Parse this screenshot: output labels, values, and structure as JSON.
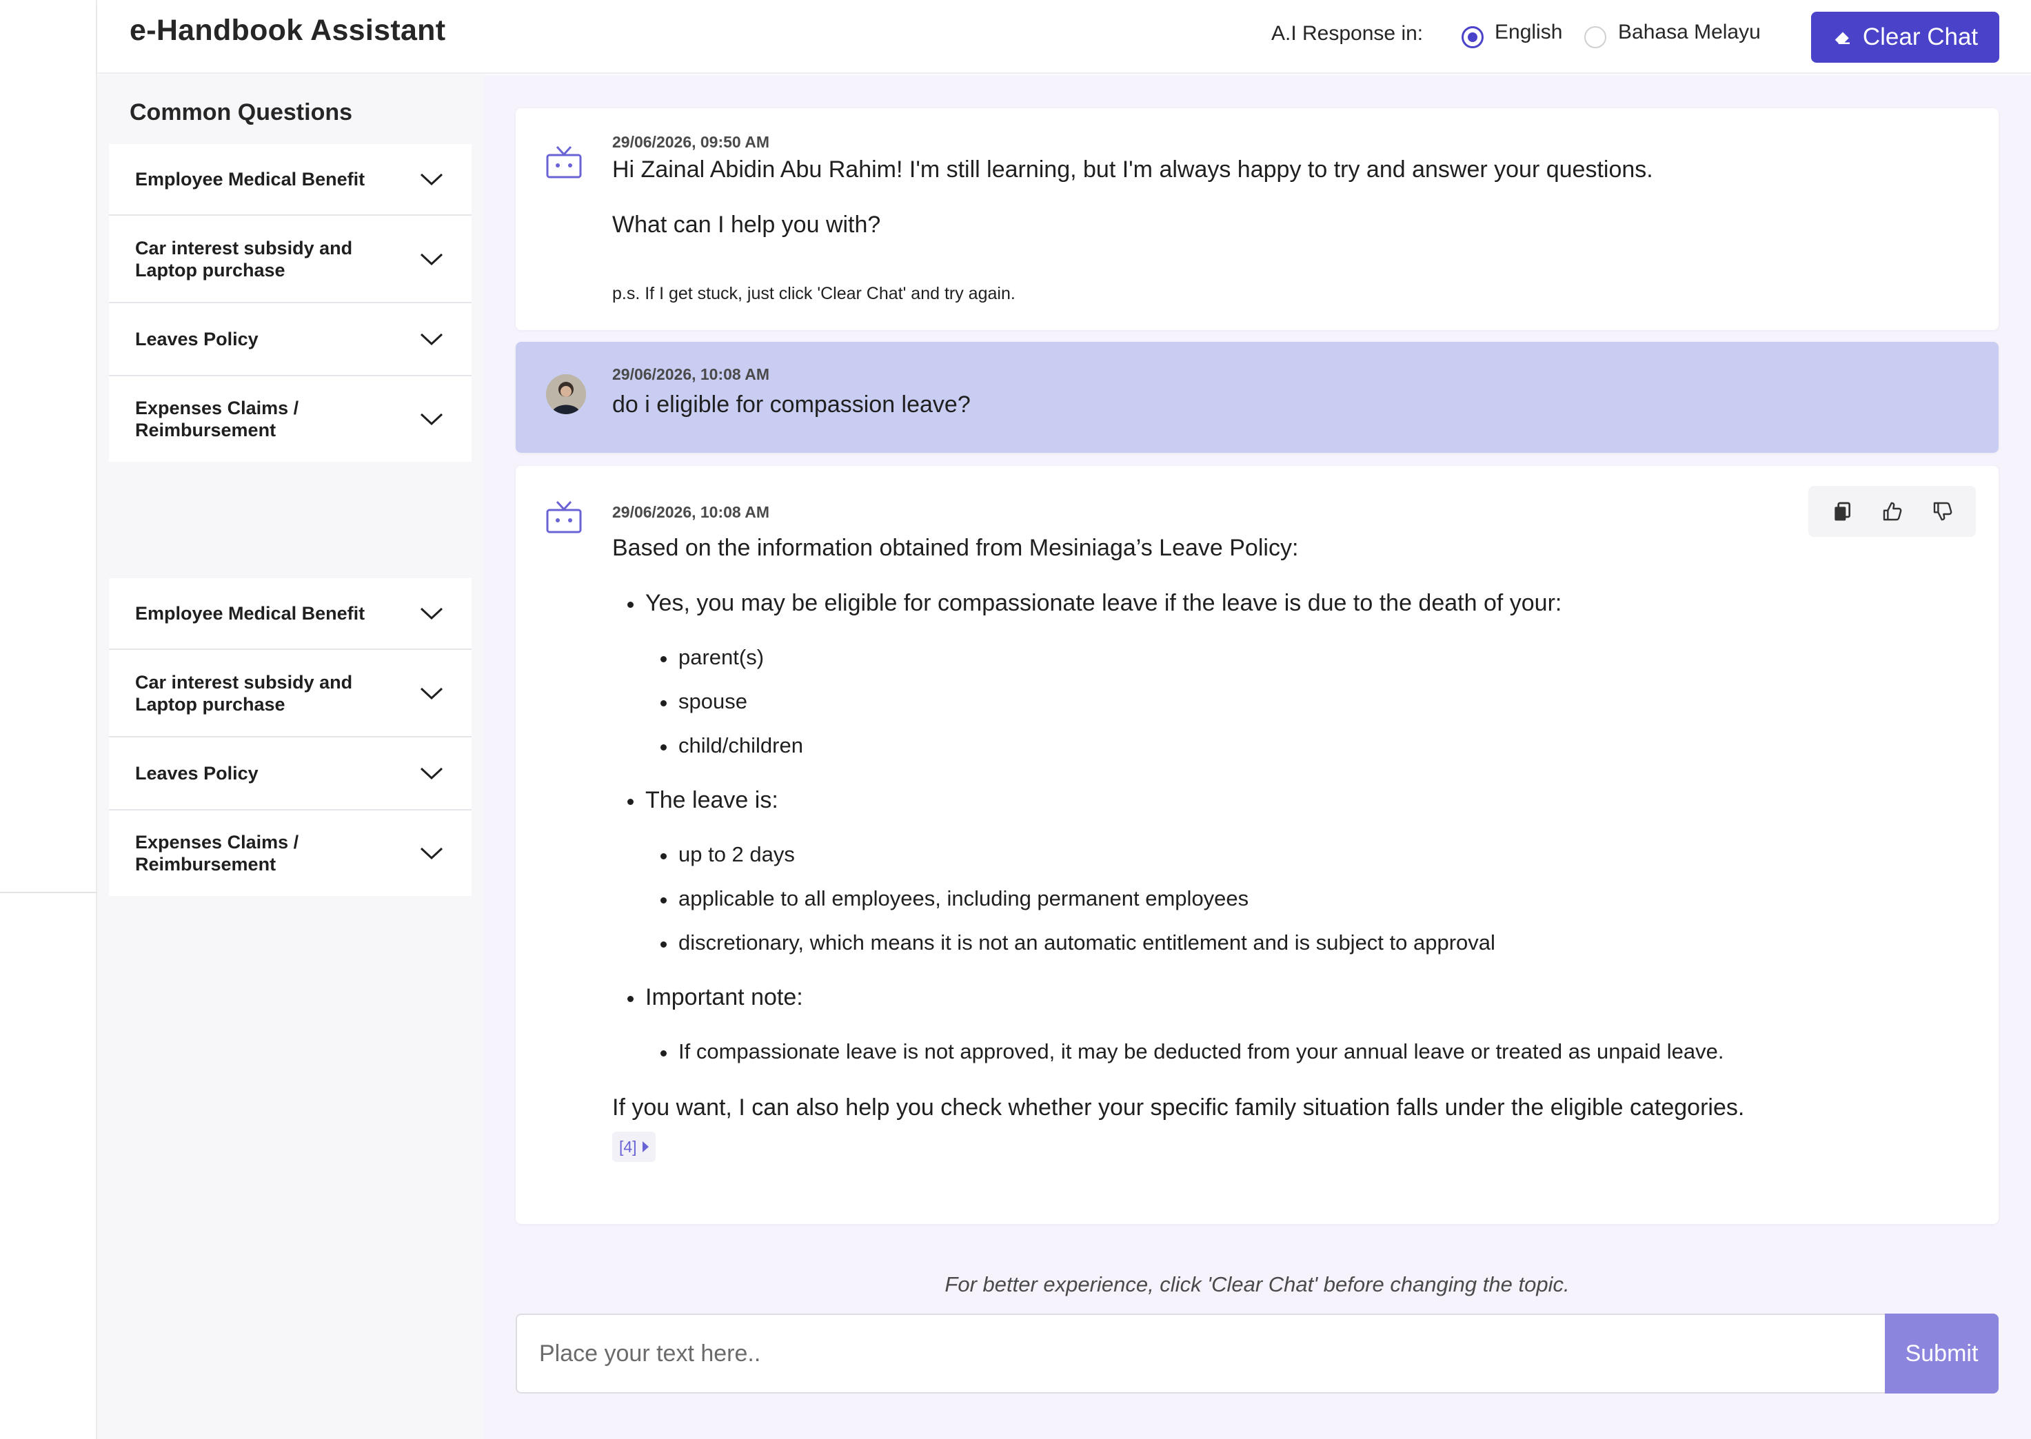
{
  "header": {
    "title": "e-Handbook Assistant",
    "language_label": "A.I Response in:",
    "languages": [
      {
        "label": "English",
        "selected": true
      },
      {
        "label": "Bahasa Melayu",
        "selected": false
      }
    ],
    "clear_chat_label": "Clear Chat",
    "clear_chat_icon": "eraser-icon",
    "accent_color": "#4a42c9"
  },
  "sidebar": {
    "title": "Common Questions",
    "groups": [
      {
        "items": [
          {
            "label": "Employee Medical Benefit"
          },
          {
            "label": "Car interest subsidy and Laptop purchase"
          },
          {
            "label": "Leaves Policy"
          },
          {
            "label": "Expenses Claims / Reimbursement"
          }
        ]
      },
      {
        "items": [
          {
            "label": "Employee Medical Benefit"
          },
          {
            "label": "Car interest subsidy and Laptop purchase"
          },
          {
            "label": "Leaves Policy"
          },
          {
            "label": "Expenses Claims / Reimbursement"
          }
        ]
      }
    ]
  },
  "chat": {
    "messages": [
      {
        "role": "assistant",
        "time": "29/06/2026, 09:50 AM",
        "greeting": "Hi Zainal Abidin Abu Rahim! I'm still learning, but I'm always happy to try and answer your questions.",
        "question": "What can I help you with?",
        "note": "p.s. If I get stuck, just click 'Clear Chat' and try again."
      },
      {
        "role": "user",
        "time": "29/06/2026, 10:08 AM",
        "text": "do i eligible for compassion leave?"
      },
      {
        "role": "assistant",
        "time": "29/06/2026, 10:08 AM",
        "intro": "Based on the information obtained from Mesiniaga’s Leave Policy:",
        "sections": [
          {
            "text": "Yes, you may be eligible for compassionate leave if the leave is due to the death of your:",
            "items": [
              "parent(s)",
              "spouse",
              "child/children"
            ]
          },
          {
            "text": "The leave is:",
            "items": [
              "up to 2 days",
              "applicable to all employees, including permanent employees",
              "discretionary, which means it is not an automatic entitlement and is subject to approval"
            ]
          },
          {
            "text": "Important note:",
            "items": [
              "If compassionate leave is not approved, it may be deducted from your annual leave or treated as unpaid leave."
            ]
          }
        ],
        "closing": "If you want, I can also help you check whether your specific family situation falls under the eligible categories.",
        "citation": "[4]",
        "actions": [
          "copy-icon",
          "thumbs-up-icon",
          "thumbs-down-icon"
        ]
      }
    ]
  },
  "composer": {
    "hint": "For better experience, click 'Clear Chat' before changing the topic.",
    "placeholder": "Place your text here..",
    "value": "",
    "submit_label": "Submit"
  },
  "colors": {
    "user_bubble": "#c8cdf1",
    "main_background": "#f6f3fd",
    "submit_button": "#8b85dd"
  }
}
